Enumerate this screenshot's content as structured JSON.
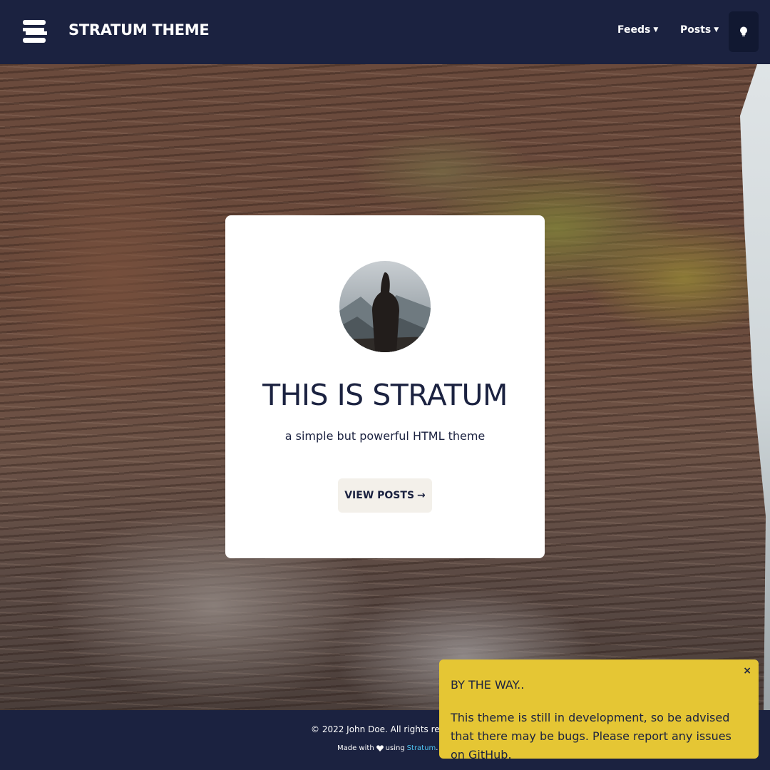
{
  "header": {
    "brand": "STRATUM THEME",
    "nav": [
      {
        "label": "Feeds"
      },
      {
        "label": "Posts"
      }
    ]
  },
  "hero": {
    "title": "THIS IS STRATUM",
    "subtitle": "a simple but powerful HTML theme",
    "cta_label": "VIEW POSTS",
    "cta_arrow": "→"
  },
  "footer": {
    "copyright": "© 2022 John Doe. All rights rese",
    "made_with_prefix": "Made with",
    "made_with_using": "using",
    "made_with_link": "Stratum",
    "made_with_suffix": "."
  },
  "notice": {
    "title": "BY THE WAY..",
    "body": "This theme is still in development, so be advised that there may be bugs. Please report any issues on GitHub.",
    "close": "×"
  },
  "icons": {
    "logo": "stratum-logo-icon",
    "caret": "caret-down-icon",
    "theme_toggle": "lightbulb-icon",
    "heart": "heart-icon"
  },
  "colors": {
    "navy": "#1b2240",
    "card": "#ffffff",
    "button": "#f3f0ea",
    "notice": "#e5c634",
    "link": "#4fc3ef"
  }
}
